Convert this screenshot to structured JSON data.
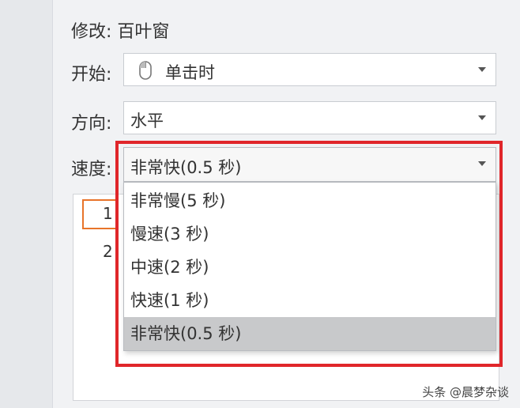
{
  "panel": {
    "title": "修改: 百叶窗"
  },
  "start": {
    "label": "开始:",
    "value": "单击时",
    "icon": "mouse-icon"
  },
  "direction": {
    "label": "方向:",
    "value": "水平"
  },
  "speed": {
    "label": "速度:",
    "selected": "非常快(0.5 秒)",
    "options": [
      "非常慢(5 秒)",
      "慢速(3 秒)",
      "中速(2 秒)",
      "快速(1 秒)",
      "非常快(0.5 秒)"
    ],
    "selected_index": 4
  },
  "animation_list": {
    "items": [
      "1",
      "2"
    ]
  },
  "watermark": "头条 @晨梦杂谈",
  "colors": {
    "highlight": "#e0262a",
    "order_box": "#e8742a",
    "selected_bg": "#c8c9cb"
  }
}
